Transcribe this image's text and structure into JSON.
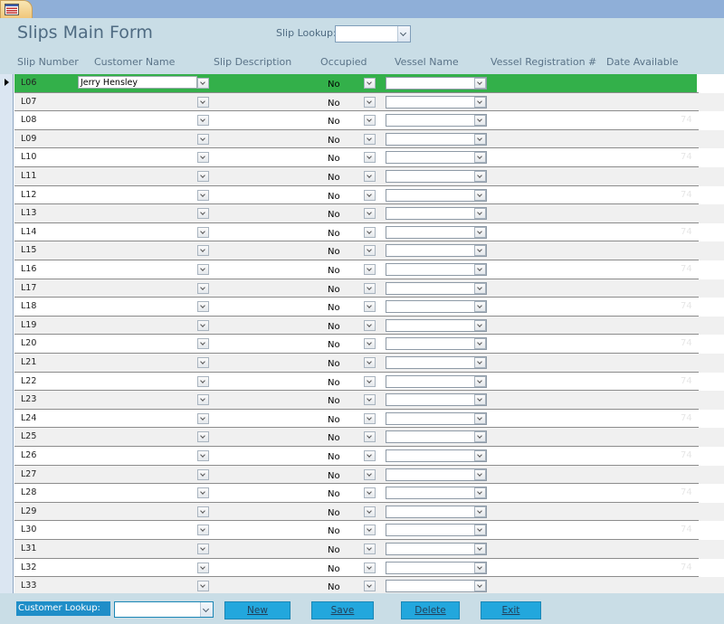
{
  "form": {
    "title": "Slips Main Form"
  },
  "slip_lookup": {
    "label": "Slip Lookup:",
    "value": ""
  },
  "columns": [
    "Slip Number",
    "Customer Name",
    "Slip Description",
    "Occupied",
    "Vessel Name",
    "Vessel Registration #",
    "Date Available"
  ],
  "rows": [
    {
      "slip": "L06",
      "customer": "Jerry Hensley",
      "occupied": "No",
      "ghost": ""
    },
    {
      "slip": "L07",
      "customer": "",
      "occupied": "No",
      "ghost": ""
    },
    {
      "slip": "L08",
      "customer": "",
      "occupied": "No",
      "ghost": "74"
    },
    {
      "slip": "L09",
      "customer": "",
      "occupied": "No",
      "ghost": ""
    },
    {
      "slip": "L10",
      "customer": "",
      "occupied": "No",
      "ghost": "74"
    },
    {
      "slip": "L11",
      "customer": "",
      "occupied": "No",
      "ghost": ""
    },
    {
      "slip": "L12",
      "customer": "",
      "occupied": "No",
      "ghost": "74"
    },
    {
      "slip": "L13",
      "customer": "",
      "occupied": "No",
      "ghost": ""
    },
    {
      "slip": "L14",
      "customer": "",
      "occupied": "No",
      "ghost": "74"
    },
    {
      "slip": "L15",
      "customer": "",
      "occupied": "No",
      "ghost": ""
    },
    {
      "slip": "L16",
      "customer": "",
      "occupied": "No",
      "ghost": "74"
    },
    {
      "slip": "L17",
      "customer": "",
      "occupied": "No",
      "ghost": ""
    },
    {
      "slip": "L18",
      "customer": "",
      "occupied": "No",
      "ghost": "74"
    },
    {
      "slip": "L19",
      "customer": "",
      "occupied": "No",
      "ghost": ""
    },
    {
      "slip": "L20",
      "customer": "",
      "occupied": "No",
      "ghost": "74"
    },
    {
      "slip": "L21",
      "customer": "",
      "occupied": "No",
      "ghost": ""
    },
    {
      "slip": "L22",
      "customer": "",
      "occupied": "No",
      "ghost": "74"
    },
    {
      "slip": "L23",
      "customer": "",
      "occupied": "No",
      "ghost": ""
    },
    {
      "slip": "L24",
      "customer": "",
      "occupied": "No",
      "ghost": "74"
    },
    {
      "slip": "L25",
      "customer": "",
      "occupied": "No",
      "ghost": ""
    },
    {
      "slip": "L26",
      "customer": "",
      "occupied": "No",
      "ghost": "74"
    },
    {
      "slip": "L27",
      "customer": "",
      "occupied": "No",
      "ghost": ""
    },
    {
      "slip": "L28",
      "customer": "",
      "occupied": "No",
      "ghost": "74"
    },
    {
      "slip": "L29",
      "customer": "",
      "occupied": "No",
      "ghost": ""
    },
    {
      "slip": "L30",
      "customer": "",
      "occupied": "No",
      "ghost": "74"
    },
    {
      "slip": "L31",
      "customer": "",
      "occupied": "No",
      "ghost": ""
    },
    {
      "slip": "L32",
      "customer": "",
      "occupied": "No",
      "ghost": "74"
    },
    {
      "slip": "L33",
      "customer": "",
      "occupied": "No",
      "ghost": ""
    }
  ],
  "footer": {
    "customer_lookup_label": "Customer Lookup:",
    "customer_lookup_value": "",
    "buttons": {
      "new": "New",
      "save": "Save",
      "delete": "Delete",
      "exit": "Exit"
    }
  },
  "colors": {
    "current_row": "#33b04a",
    "header_bg": "#c9dde6",
    "button": "#22a7dd"
  }
}
